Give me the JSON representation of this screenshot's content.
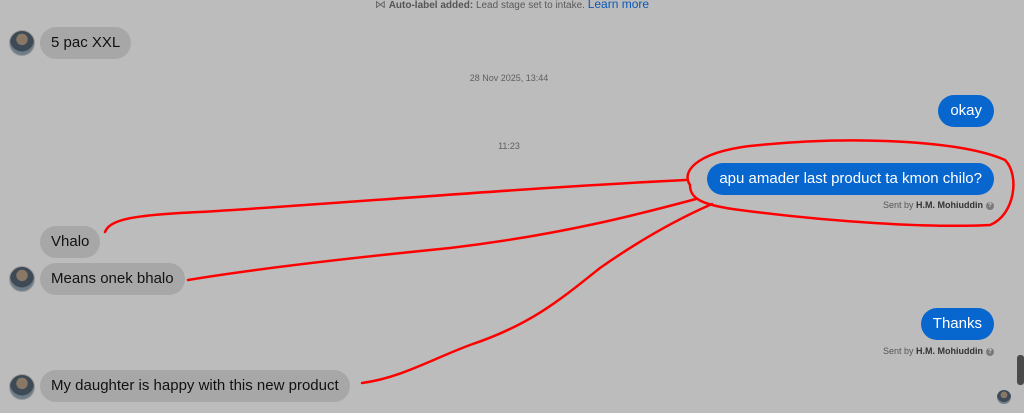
{
  "system_notice": {
    "label": "Auto-label added:",
    "text": "Lead stage set to intake.",
    "link": "Learn more"
  },
  "timestamps": [
    "28 Nov 2025, 13:44",
    "11:23"
  ],
  "messages": {
    "in_1": "5 pac XXL",
    "out_1": "okay",
    "out_2": "apu amader last product ta kmon chilo?",
    "in_2": "Vhalo",
    "in_3": "Means onek bhalo",
    "out_3": "Thanks",
    "in_4": "My daughter  is happy with this new product"
  },
  "sent_by": {
    "prefix": "Sent by",
    "name": "H.M. Mohiuddin"
  },
  "colors": {
    "background": "#bcbcbc",
    "incoming_bubble": "#a7a7a7",
    "outgoing_bubble": "#0866cf",
    "annotation": "#ff0000"
  }
}
